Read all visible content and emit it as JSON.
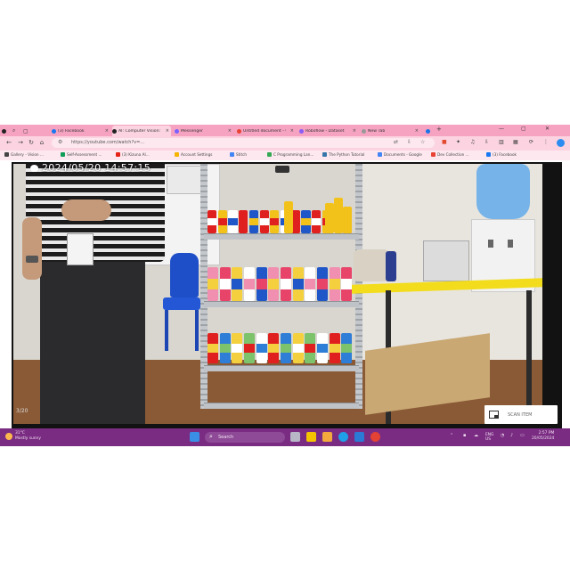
{
  "browser": {
    "tabs": [
      {
        "title": "(3) Facebook",
        "color": "#1877f2",
        "active": false
      },
      {
        "title": "AI: Computer Vision: Sm",
        "color": "#222222",
        "active": true
      },
      {
        "title": "Messenger",
        "color": "#7b61ff",
        "active": false
      },
      {
        "title": "Untitled document - Go",
        "color": "#e94235",
        "active": false
      },
      {
        "title": "Roboflow - Dataset",
        "color": "#8b5cf6",
        "active": false
      },
      {
        "title": "New Tab",
        "color": "#999999",
        "active": false
      },
      {
        "title": "Label Studio",
        "color": "#1a73e8",
        "active": false
      }
    ],
    "new_tab_label": "+",
    "window_controls": {
      "minimize": "—",
      "maximize": "▢",
      "close": "✕"
    },
    "address": {
      "url": "https://youtube.com/watch?v=...",
      "tune_icon": "tune-icon",
      "icons": [
        "translate-icon",
        "star-icon",
        "download-icon"
      ]
    },
    "nav": {
      "back": "←",
      "forward": "→",
      "reload": "↻",
      "home": "⌂"
    },
    "bookmarks": [
      {
        "label": "Gallery - Vision ...",
        "color": "#444444"
      },
      {
        "label": "Self-Assessment ...",
        "color": "#0f9d58"
      },
      {
        "label": "(3) Kizuna AI...",
        "color": "#e62117"
      },
      {
        "label": "Account Settings",
        "color": "#f4b400"
      },
      {
        "label": "Stitch",
        "color": "#4285f4"
      },
      {
        "label": "C Programming Lan...",
        "color": "#34a853"
      },
      {
        "label": "The Python Tutorial",
        "color": "#3776ab"
      },
      {
        "label": "Documents - Google",
        "color": "#4285f4"
      },
      {
        "label": "Dev Collection ...",
        "color": "#e94235"
      },
      {
        "label": "(3) Facebook",
        "color": "#1877f2"
      }
    ]
  },
  "video": {
    "timestamp": "2024/05/20  14:57:15",
    "counter": "3/20",
    "scan_button_label": "SCAN ITEM"
  },
  "taskbar": {
    "weather_temp": "31°C",
    "weather_desc": "Mostly sunny",
    "search_label": "Search",
    "tray_lang": "ENG",
    "tray_region": "US",
    "time": "2:57 PM",
    "date": "20/05/2024"
  }
}
